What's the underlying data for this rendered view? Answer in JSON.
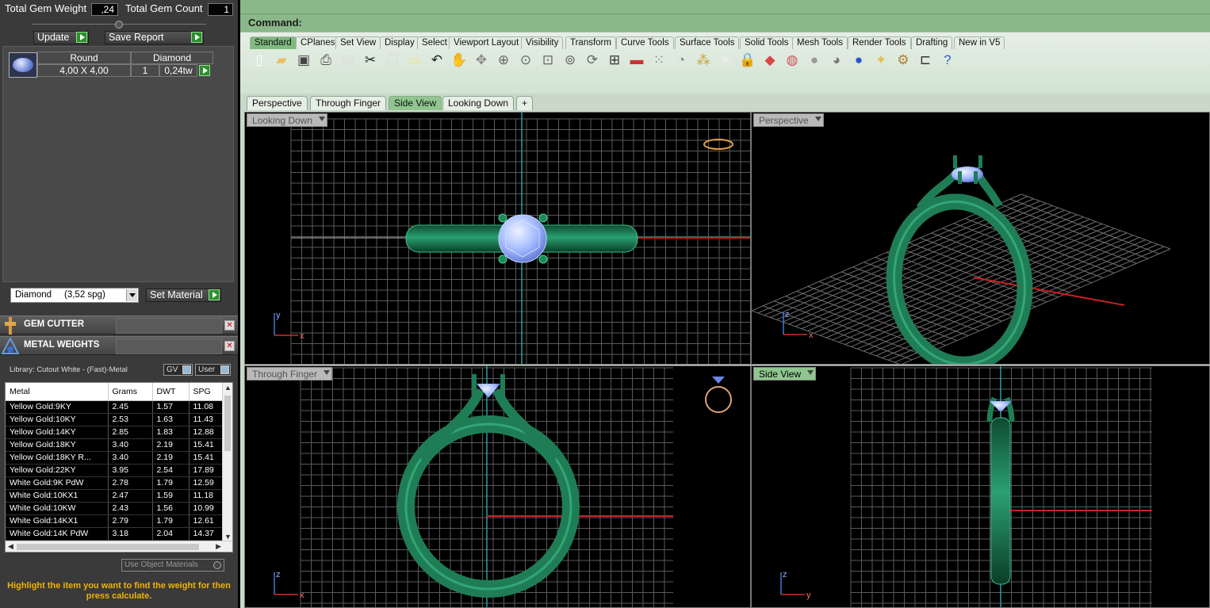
{
  "gem_summary": {
    "total_weight_label": "Total Gem Weight",
    "total_weight_value": ",24",
    "total_count_label": "Total Gem Count",
    "total_count_value": "1",
    "update_label": "Update",
    "save_report_label": "Save Report"
  },
  "gem_list": {
    "header_shape": "Round",
    "header_type": "Diamond",
    "size": "4,00 X 4,00",
    "count": "1",
    "weight": "0,24tw"
  },
  "material": {
    "selected": "Diamond     (3,52 spg)",
    "set_label": "Set Material"
  },
  "sections": {
    "gem_cutter": "GEM CUTTER",
    "metal_weights": "METAL WEIGHTS"
  },
  "library": {
    "label": "Library: Cutout White - (Fast)-Metal",
    "gv_label": "GV",
    "user_label": "User"
  },
  "metal_table": {
    "columns": [
      "Metal",
      "Grams",
      "DWT",
      "SPG"
    ],
    "rows": [
      [
        "Yellow Gold:9KY",
        "2.45",
        "1.57",
        "11.08"
      ],
      [
        "Yellow Gold:10KY",
        "2.53",
        "1.63",
        "11.43"
      ],
      [
        "Yellow Gold:14KY",
        "2.85",
        "1.83",
        "12.88"
      ],
      [
        "Yellow Gold:18KY",
        "3.40",
        "2.19",
        "15.41"
      ],
      [
        "Yellow Gold:18KY R...",
        "3.40",
        "2.19",
        "15.41"
      ],
      [
        "Yellow Gold:22KY",
        "3.95",
        "2.54",
        "17.89"
      ],
      [
        "White Gold:9K PdW",
        "2.78",
        "1.79",
        "12.59"
      ],
      [
        "White Gold:10KX1",
        "2.47",
        "1.59",
        "11.18"
      ],
      [
        "White Gold:10KW",
        "2.43",
        "1.56",
        "10.99"
      ],
      [
        "White Gold:14KX1",
        "2.79",
        "1.79",
        "12.61"
      ],
      [
        "White Gold:14K PdW",
        "3.18",
        "2.04",
        "14.37"
      ]
    ]
  },
  "use_object_materials": "Use Object Materials",
  "hint": "Highlight the item you want to find the weight for then press calculate.",
  "command": {
    "label": "Command:"
  },
  "toolbar_tabs": [
    "Standard",
    "CPlanes",
    "Set View",
    "Display",
    "Select",
    "Viewport Layout",
    "Visibility",
    "Transform",
    "Curve Tools",
    "Surface Tools",
    "Solid Tools",
    "Mesh Tools",
    "Render Tools",
    "Drafting",
    "New in V5"
  ],
  "toolbar_icons": [
    "new-file-icon",
    "open-folder-icon",
    "save-icon",
    "print-icon",
    "import-icon",
    "cut-icon",
    "copy-icon",
    "paste-icon",
    "undo-icon",
    "pan-hand-icon",
    "move-arrows-icon",
    "zoom-icon",
    "zoom-window-icon",
    "zoom-extents-icon",
    "zoom-selected-icon",
    "rotate-view-icon",
    "four-viewports-icon",
    "car-icon",
    "render-dots-icon",
    "circle-icon",
    "points-icon",
    "lightbulb-icon",
    "lock-icon",
    "layers-icon",
    "color-wheel-icon",
    "shaded-sphere-icon",
    "rendered-sphere-icon",
    "blue-sphere-icon",
    "light-icon",
    "settings-gear-icon",
    "cplane-icon",
    "help-icon"
  ],
  "view_tabs": [
    "Perspective",
    "Through Finger",
    "Side View",
    "Looking Down"
  ],
  "add_tab": "+",
  "viewports": {
    "top_left": "Looking Down",
    "top_right": "Perspective",
    "bottom_left": "Through Finger",
    "bottom_right": "Side View"
  },
  "axes": {
    "x": "x",
    "y": "y",
    "z": "z"
  },
  "colors": {
    "ring_green": "#1f7d55",
    "gem_blue": "#9eb6ff",
    "grid": "#5a5a5a",
    "hint_text": "#f0b400",
    "active_tab": "#8fc68f"
  }
}
